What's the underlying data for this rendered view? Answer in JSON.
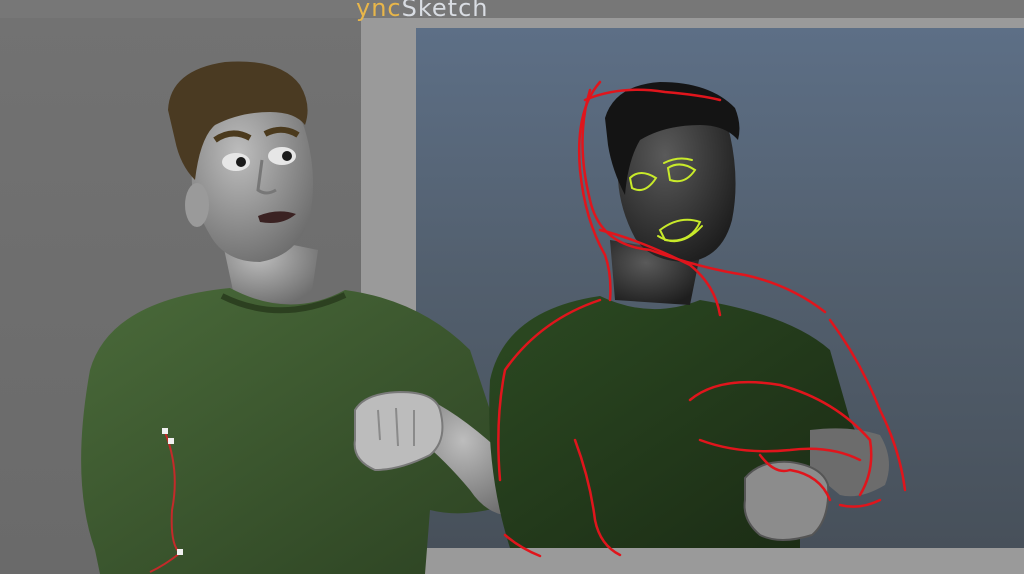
{
  "overlay": {
    "title_part1": "ync",
    "title_part2": "Sketch"
  },
  "colors": {
    "viewport_bg": "#6b6b6b",
    "panel_frame": "#9a9a9a",
    "panel_bg": "#53606f",
    "shirt": "#3d5530",
    "skin": "#9a9a9a",
    "hair": "#4a3a22",
    "sketch_red": "#e0151c",
    "sketch_yellow": "#c8ea2a"
  }
}
